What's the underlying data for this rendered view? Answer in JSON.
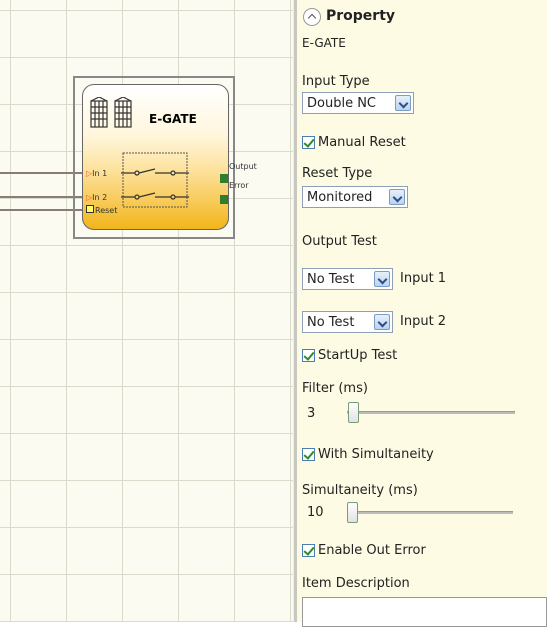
{
  "canvas": {
    "block": {
      "title": "E-GATE",
      "inputs": [
        "In 1",
        "In 2",
        "Reset"
      ],
      "outputs": [
        "Output",
        "Error"
      ]
    }
  },
  "panel": {
    "header": "Property",
    "block_name": "E-GATE",
    "input_type": {
      "label": "Input Type",
      "value": "Double NC"
    },
    "manual_reset": {
      "label": "Manual Reset",
      "checked": true
    },
    "reset_type": {
      "label": "Reset Type",
      "value": "Monitored"
    },
    "output_test": {
      "label": "Output Test",
      "rows": [
        {
          "value": "No Test",
          "label": "Input 1"
        },
        {
          "value": "No Test",
          "label": "Input 2"
        }
      ]
    },
    "startup_test": {
      "label": "StartUp Test",
      "checked": true
    },
    "filter": {
      "label": "Filter (ms)",
      "value": "3"
    },
    "with_simultaneity": {
      "label": "With Simultaneity",
      "checked": true
    },
    "simultaneity": {
      "label": "Simultaneity (ms)",
      "value": "10"
    },
    "enable_out_error": {
      "label": "Enable Out Error",
      "checked": true
    },
    "item_description": {
      "label": "Item Description",
      "value": ""
    }
  }
}
